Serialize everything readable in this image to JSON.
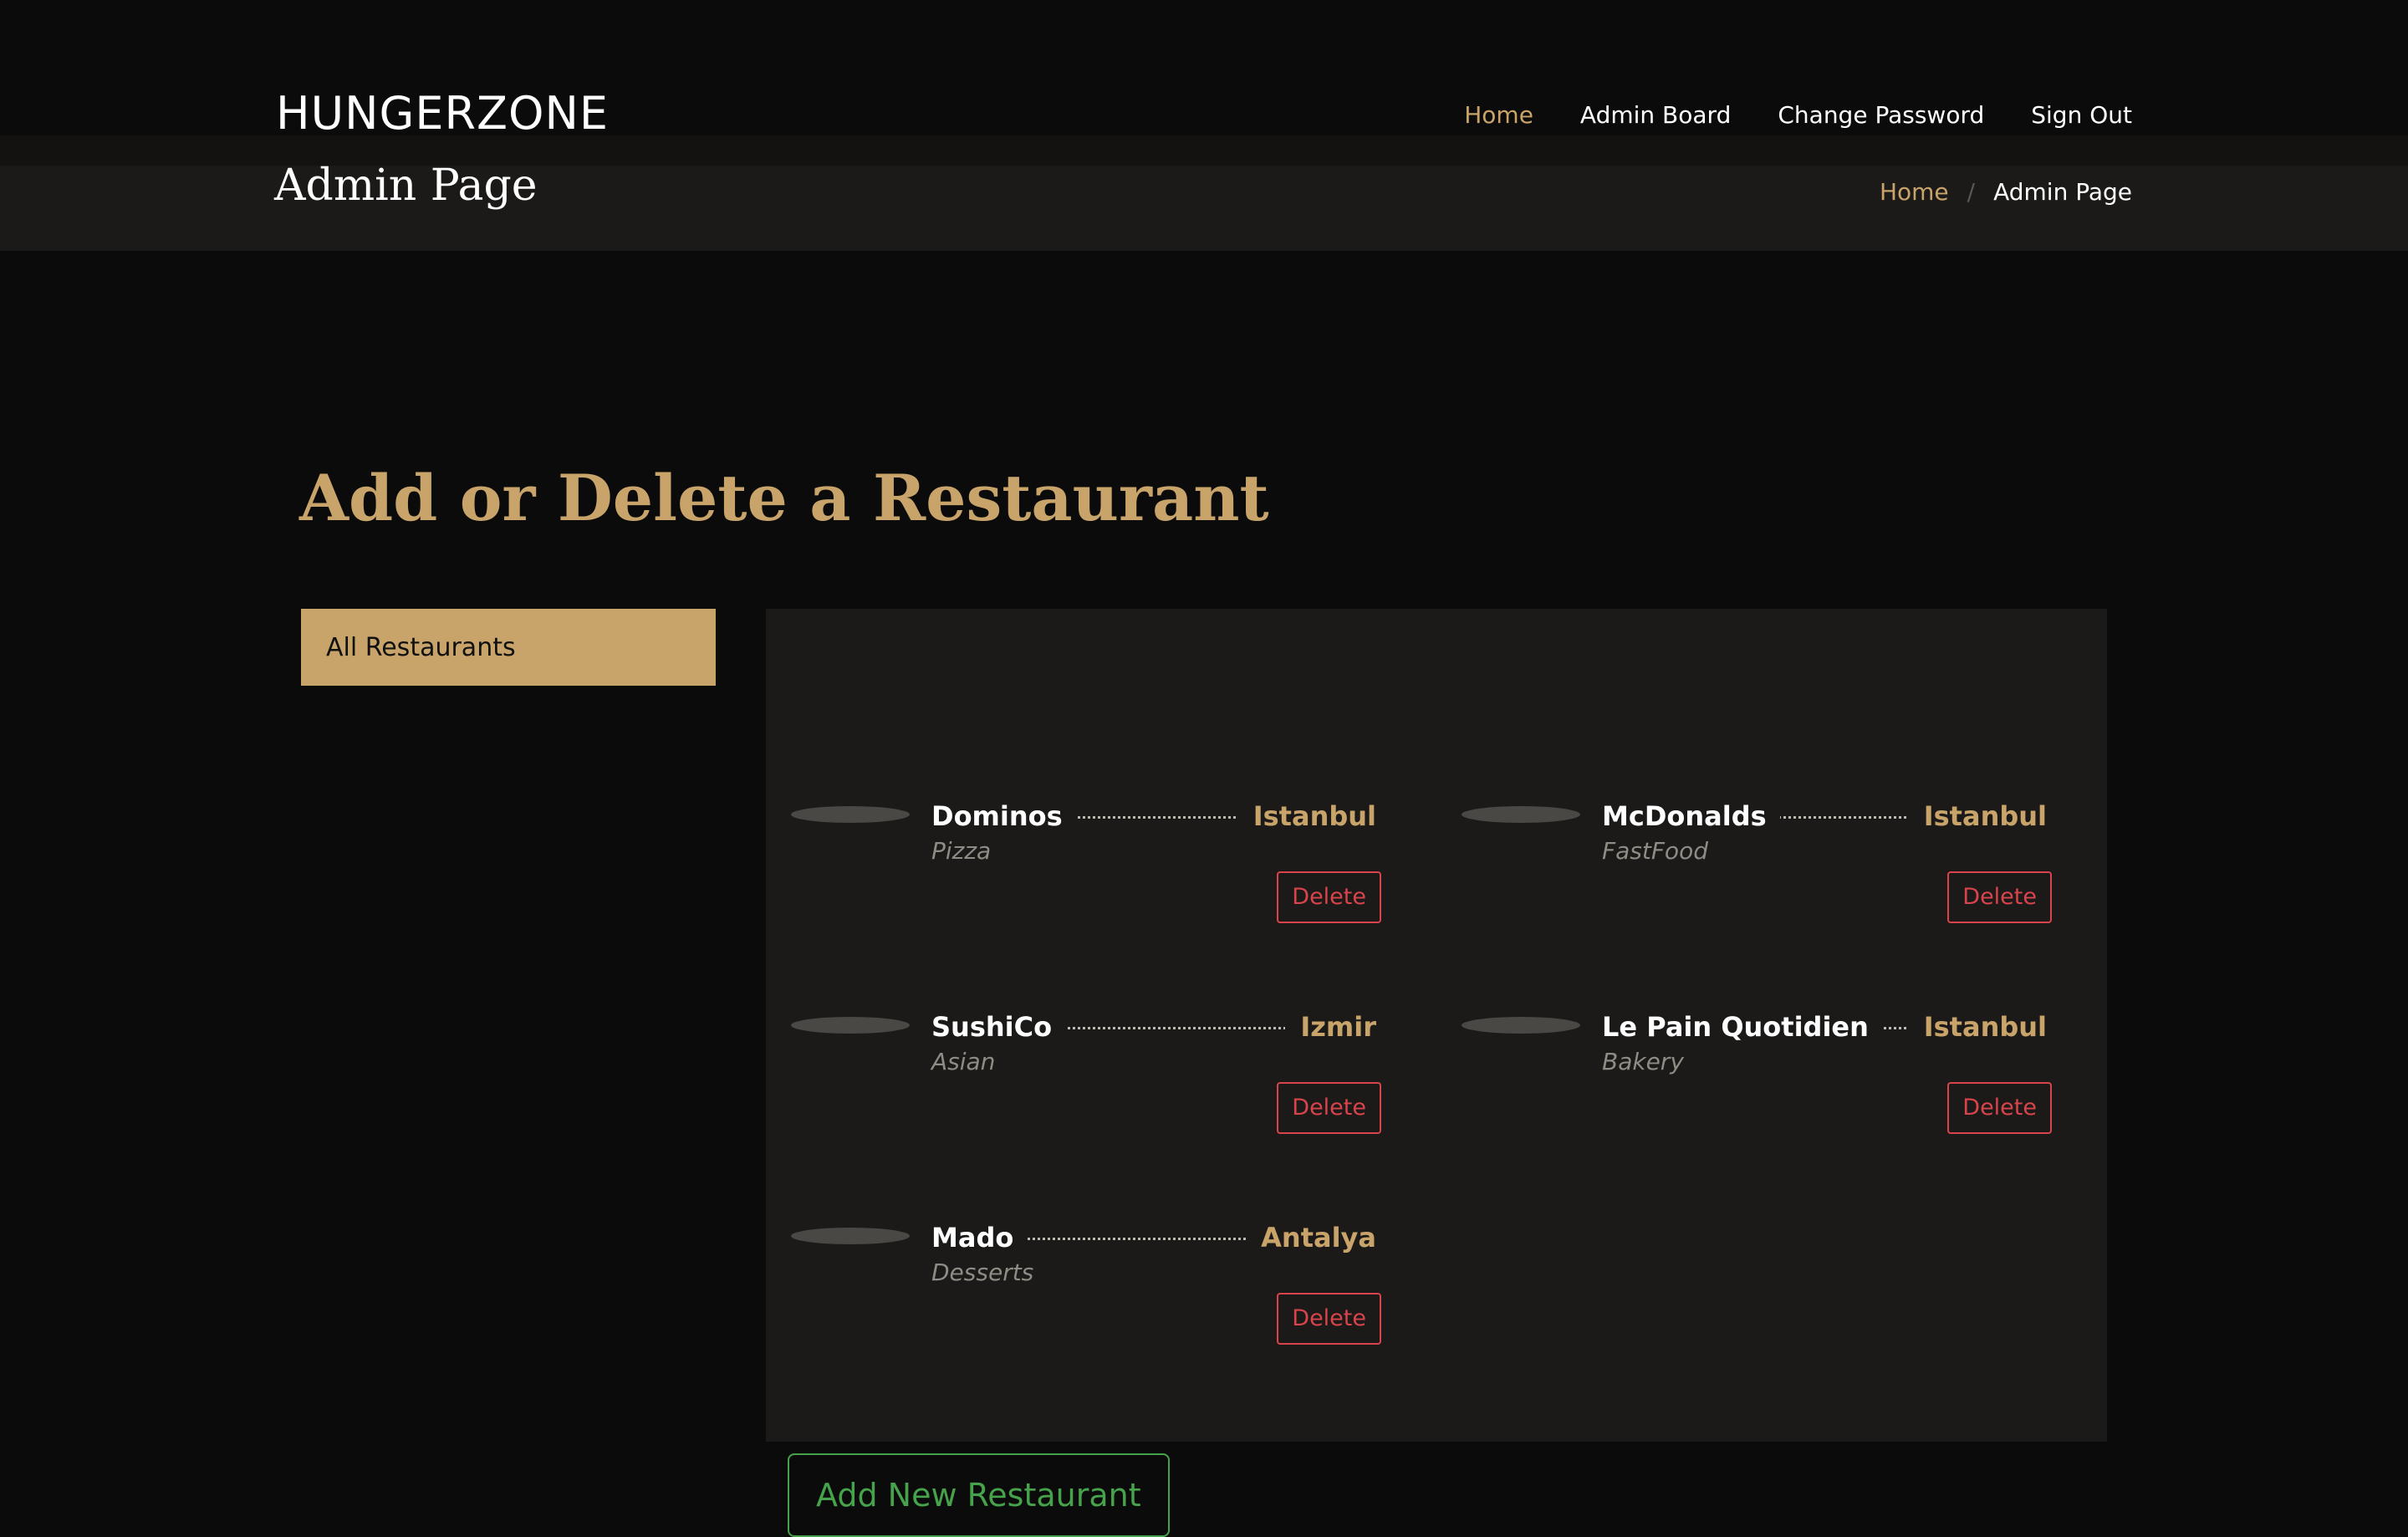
{
  "header": {
    "logo": "HUNGERZONE",
    "nav": [
      {
        "label": "Home",
        "active": true
      },
      {
        "label": "Admin Board",
        "active": false
      },
      {
        "label": "Change Password",
        "active": false
      },
      {
        "label": "Sign Out",
        "active": false
      }
    ]
  },
  "titlebar": {
    "title": "Admin Page",
    "breadcrumb": {
      "home": "Home",
      "separator": "/",
      "current": "Admin Page"
    }
  },
  "main": {
    "heading": "Add or Delete a Restaurant",
    "filter_tab": "All Restaurants",
    "restaurants": [
      {
        "name": "Dominos",
        "city": "Istanbul",
        "category": "Pizza",
        "delete_label": "Delete"
      },
      {
        "name": "McDonalds",
        "city": "Istanbul",
        "category": "FastFood",
        "delete_label": "Delete"
      },
      {
        "name": "SushiCo",
        "city": "Izmir",
        "category": "Asian",
        "delete_label": "Delete"
      },
      {
        "name": "Le Pain Quotidien",
        "city": "Istanbul",
        "category": "Bakery",
        "delete_label": "Delete"
      },
      {
        "name": "Mado",
        "city": "Antalya",
        "category": "Desserts",
        "delete_label": "Delete"
      }
    ],
    "add_button": "Add New Restaurant"
  },
  "colors": {
    "background": "#0c0b0b",
    "panel": "#1b1a18",
    "accent": "#c9a46a",
    "danger": "#d9444c",
    "success": "#46a34b"
  }
}
